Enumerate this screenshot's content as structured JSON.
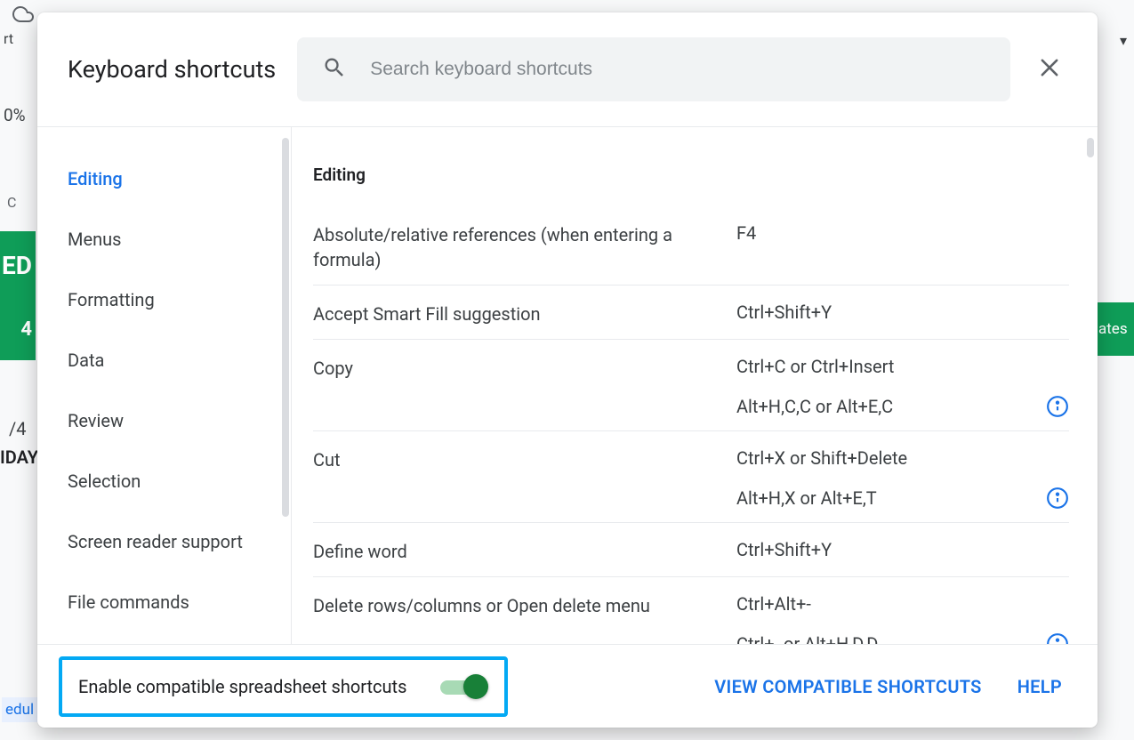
{
  "bg": {
    "rt": "rt",
    "pct": "0%",
    "ed": "ED",
    "four": "4",
    "ates": "ates",
    "date": "/4",
    "day": "IDAY",
    "edul": "edul",
    "c": "C",
    "caret": "▾"
  },
  "dialog": {
    "title": "Keyboard shortcuts",
    "search_placeholder": "Search keyboard shortcuts"
  },
  "sidebar": {
    "items": [
      {
        "label": "Editing",
        "active": true
      },
      {
        "label": "Menus",
        "active": false
      },
      {
        "label": "Formatting",
        "active": false
      },
      {
        "label": "Data",
        "active": false
      },
      {
        "label": "Review",
        "active": false
      },
      {
        "label": "Selection",
        "active": false
      },
      {
        "label": "Screen reader support",
        "active": false
      },
      {
        "label": "File commands",
        "active": false
      }
    ]
  },
  "content": {
    "section_title": "Editing",
    "rows": [
      {
        "desc": "Absolute/relative references (when entering a formula)",
        "keys": [
          "F4"
        ],
        "info": false
      },
      {
        "desc": "Accept Smart Fill suggestion",
        "keys": [
          "Ctrl+Shift+Y"
        ],
        "info": false
      },
      {
        "desc": "Copy",
        "keys": [
          "Ctrl+C or Ctrl+Insert",
          "Alt+H,C,C or Alt+E,C"
        ],
        "info": true
      },
      {
        "desc": "Cut",
        "keys": [
          "Ctrl+X or Shift+Delete",
          "Alt+H,X or Alt+E,T"
        ],
        "info": true
      },
      {
        "desc": "Define word",
        "keys": [
          "Ctrl+Shift+Y"
        ],
        "info": false
      },
      {
        "desc": "Delete rows/columns or Open delete menu",
        "keys": [
          "Ctrl+Alt+-",
          "Ctrl+- or Alt+H,D,D"
        ],
        "info": true
      }
    ]
  },
  "footer": {
    "enable_label": "Enable compatible spreadsheet shortcuts",
    "toggle_on": true,
    "view_link": "VIEW COMPATIBLE SHORTCUTS",
    "help_link": "HELP"
  }
}
